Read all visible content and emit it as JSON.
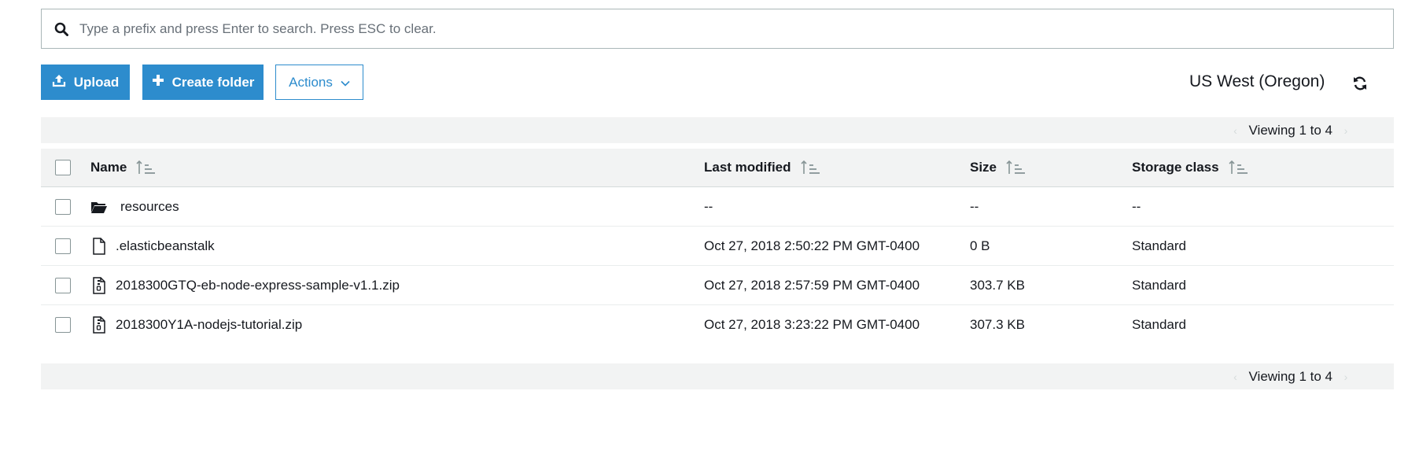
{
  "search": {
    "placeholder": "Type a prefix and press Enter to search. Press ESC to clear.",
    "icon": "search-icon"
  },
  "toolbar": {
    "upload_label": "Upload",
    "create_folder_label": "Create folder",
    "actions_label": "Actions",
    "region": "US West (Oregon)"
  },
  "pagination": {
    "viewing_text": "Viewing 1 to 4"
  },
  "table": {
    "headers": {
      "name": "Name",
      "last_modified": "Last modified",
      "size": "Size",
      "storage_class": "Storage class"
    },
    "rows": [
      {
        "type": "folder",
        "name": "resources",
        "last_modified": "--",
        "size": "--",
        "storage_class": "--"
      },
      {
        "type": "file",
        "name": ".elasticbeanstalk",
        "last_modified": "Oct 27, 2018 2:50:22 PM GMT-0400",
        "size": "0 B",
        "storage_class": "Standard"
      },
      {
        "type": "zip",
        "name": "2018300GTQ-eb-node-express-sample-v1.1.zip",
        "last_modified": "Oct 27, 2018 2:57:59 PM GMT-0400",
        "size": "303.7 KB",
        "storage_class": "Standard"
      },
      {
        "type": "zip",
        "name": "2018300Y1A-nodejs-tutorial.zip",
        "last_modified": "Oct 27, 2018 3:23:22 PM GMT-0400",
        "size": "307.3 KB",
        "storage_class": "Standard"
      }
    ]
  },
  "colors": {
    "accent": "#2d8ccd",
    "header_bg": "#f2f3f3",
    "text": "#16191f"
  }
}
